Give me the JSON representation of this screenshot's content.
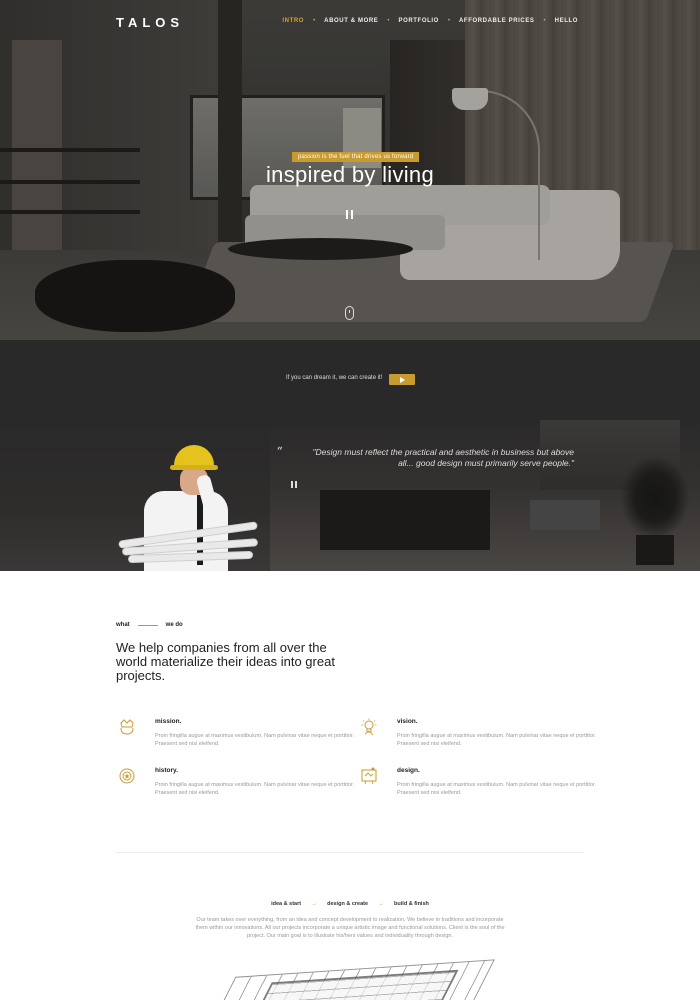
{
  "brand": {
    "logo": "TALOS",
    "accent": "#c99a2e"
  },
  "nav": {
    "items": [
      {
        "label": "INTRO",
        "active": true
      },
      {
        "label": "ABOUT & MORE",
        "active": false
      },
      {
        "label": "PORTFOLIO",
        "active": false
      },
      {
        "label": "AFFORDABLE PRICES",
        "active": false
      },
      {
        "label": "HELLO",
        "active": false
      }
    ]
  },
  "hero": {
    "tagline": "passion is the fuel that drives us forward",
    "title": "inspired by living",
    "pause_icon": "pause-icon",
    "scroll_icon": "mouse-scroll-icon"
  },
  "cta": {
    "text": "If you can dream it, we can create it!",
    "play_icon": "play-icon"
  },
  "quote": {
    "mark": "“",
    "text": "\"Design must reflect the practical and aesthetic in business but above all... good design must primarily serve people.\""
  },
  "what_we_do": {
    "tag_left": "what",
    "tag_right": "we do",
    "heading": "We help companies from all over the world materialize their ideas into great projects.",
    "features": [
      {
        "title": "mission.",
        "text": "Proin fringilla augue at maximus vestibulum. Nam pulvinar vitae neque et porttitor. Praesent sed nisi eleifend.",
        "icon": "crown-hand-icon"
      },
      {
        "title": "vision.",
        "text": "Proin fringilla augue at maximus vestibulum. Nam pulvinar vitae neque et porttitor. Praesent sed nisi eleifend.",
        "icon": "lightbulb-icon"
      },
      {
        "title": "history.",
        "text": "Proin fringilla augue at maximus vestibulum. Nam pulvinar vitae neque et porttitor. Praesent sed nisi eleifend.",
        "icon": "medal-icon"
      },
      {
        "title": "design.",
        "text": "Proin fringilla augue at maximus vestibulum. Nam pulvinar vitae neque et porttitor. Praesent sed nisi eleifend.",
        "icon": "design-board-icon"
      }
    ]
  },
  "process": {
    "steps": [
      "idea & start",
      "design & create",
      "build & finish"
    ],
    "arrow": "→",
    "text": "Our team takes over everything, from an idea and concept development to realization. We believe in traditions and incorporate them within our innovations. All our projects incorporate a unique artistic image and functional solutions. Client is the soul of the project. Our main goal is to illustrate his/hers values and individuality through design."
  }
}
